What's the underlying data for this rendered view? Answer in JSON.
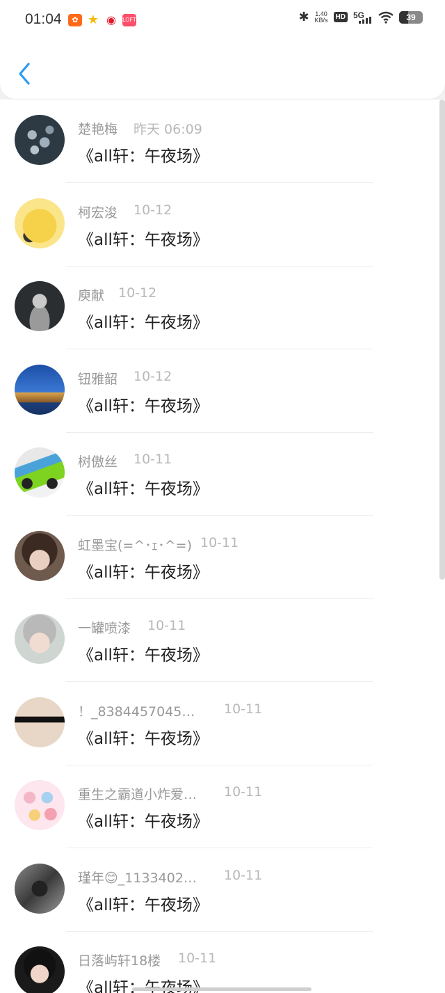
{
  "status_bar": {
    "time": "01:04",
    "net_speed_value": "1.40",
    "net_speed_unit": "KB/s",
    "hd": "HD",
    "signal": "5G",
    "battery": "39",
    "app_icons": [
      "kuaishou-icon",
      "star-app-icon",
      "weibo-icon",
      "lofter-icon"
    ],
    "lofter_text": "LOFTER"
  },
  "header": {
    "back_icon": "chevron-left-icon",
    "accent": "#2b9bf0"
  },
  "messages": [
    {
      "name": "楚艳梅",
      "time": "昨天 06:09",
      "text": "《all轩：午夜场》"
    },
    {
      "name": "柯宏浚",
      "time": "10-12",
      "text": "《all轩：午夜场》"
    },
    {
      "name": "庾献",
      "time": "10-12",
      "text": "《all轩：午夜场》"
    },
    {
      "name": "钮雅韶",
      "time": "10-12",
      "text": "《all轩：午夜场》"
    },
    {
      "name": "树傲丝",
      "time": "10-11",
      "text": "《all轩：午夜场》"
    },
    {
      "name": "虹墨宝(=^･ｪ･^=)",
      "time": "10-11",
      "text": "《all轩：午夜场》"
    },
    {
      "name": "一罐喷漆",
      "time": "10-11",
      "text": "《all轩：午夜场》"
    },
    {
      "name": "！_8384457045…",
      "time": "10-11",
      "text": "《all轩：午夜场》"
    },
    {
      "name": "重生之霸道小炸爱…",
      "time": "10-11",
      "text": "《all轩：午夜场》"
    },
    {
      "name": "瑾年😊_1133402…",
      "time": "10-11",
      "text": "《all轩：午夜场》"
    },
    {
      "name": "日落屿轩18楼",
      "time": "10-11",
      "text": "《all轩：午夜场》"
    }
  ]
}
